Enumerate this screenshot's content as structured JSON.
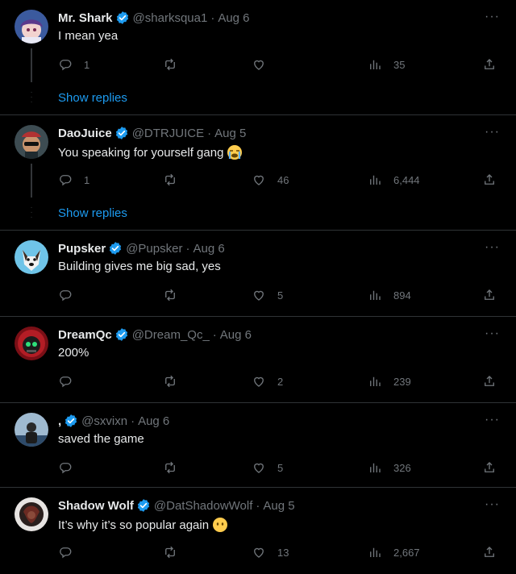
{
  "colors": {
    "accent": "#1d9bf0",
    "background": "#000000",
    "text": "#e7e9ea",
    "muted": "#71767b",
    "divider": "#2f3336"
  },
  "posts": [
    {
      "name": "Mr. Shark",
      "handle": "@sharksqua1",
      "date": "Aug 6",
      "text": "I mean yea",
      "replies": "1",
      "retweets": "",
      "likes": "",
      "views": "35",
      "emoji": null,
      "avatar": "anime-avatar",
      "show_replies": "Show replies"
    },
    {
      "name": "DaoJuice",
      "handle": "@DTRJUICE",
      "date": "Aug 5",
      "text": "You speaking for yourself gang",
      "replies": "1",
      "retweets": "",
      "likes": "46",
      "views": "6,444",
      "emoji": "crying-face-emoji",
      "avatar": "sunglasses-avatar",
      "show_replies": "Show replies"
    },
    {
      "name": "Pupsker",
      "handle": "@Pupsker",
      "date": "Aug 6",
      "text": "Building gives me big sad, yes",
      "replies": "",
      "retweets": "",
      "likes": "5",
      "views": "894",
      "emoji": null,
      "avatar": "dog-avatar",
      "show_replies": null
    },
    {
      "name": "DreamQc",
      "handle": "@Dream_Qc_",
      "date": "Aug 6",
      "text": "200%",
      "replies": "",
      "retweets": "",
      "likes": "2",
      "views": "239",
      "emoji": null,
      "avatar": "robot-avatar",
      "show_replies": null
    },
    {
      "name": ",",
      "handle": "@sxvixn",
      "date": "Aug 6",
      "text": "saved the game",
      "replies": "",
      "retweets": "",
      "likes": "5",
      "views": "326",
      "emoji": null,
      "avatar": "photo-avatar",
      "show_replies": null
    },
    {
      "name": "Shadow Wolf",
      "handle": "@DatShadowWolf",
      "date": "Aug 5",
      "text": "It’s why it’s so popular again",
      "replies": "",
      "retweets": "",
      "likes": "13",
      "views": "2,667",
      "emoji": "no-mouth-face-emoji",
      "avatar": "dark-avatar",
      "show_replies": null
    }
  ],
  "more_label": "···",
  "separator": "·"
}
